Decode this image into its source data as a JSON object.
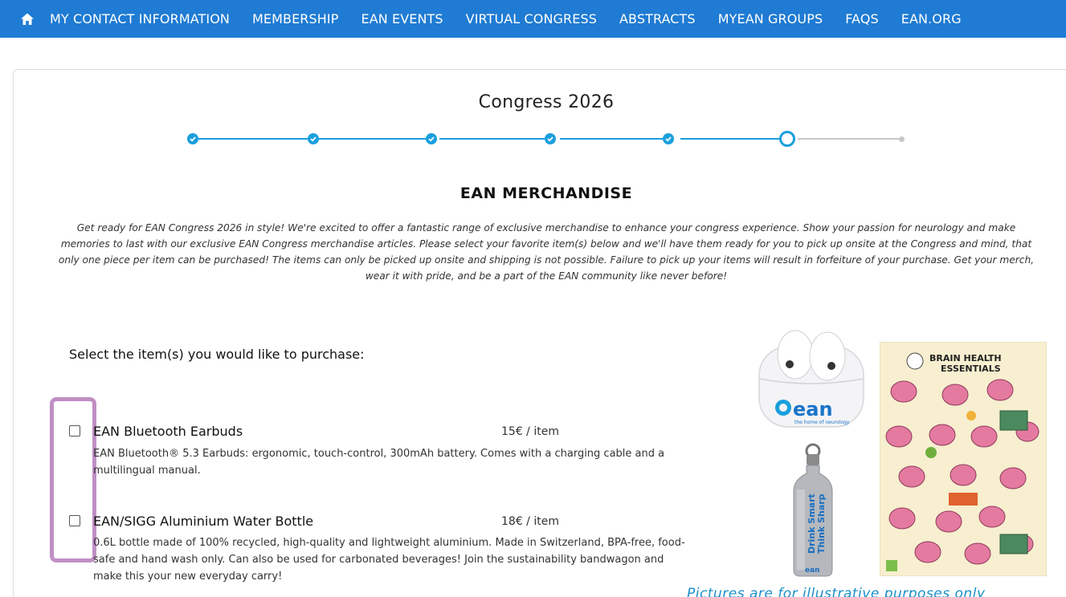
{
  "nav": {
    "items": [
      "MY CONTACT INFORMATION",
      "MEMBERSHIP",
      "EAN EVENTS",
      "VIRTUAL CONGRESS",
      "ABSTRACTS",
      "MYEAN GROUPS",
      "FAQS",
      "EAN.ORG"
    ]
  },
  "page": {
    "title": "Congress 2026",
    "stepper": {
      "total_steps": 7,
      "completed_steps": 5,
      "current_step": 6
    },
    "section_heading": "EAN MERCHANDISE",
    "intro": "Get ready for EAN Congress 2026 in style! We're excited to offer a fantastic range of exclusive merchandise to enhance your congress experience. Show your passion for neurology and make memories to last with our exclusive EAN Congress merchandise articles. Please select your favorite item(s) below and we'll have them ready for you to pick up onsite at the Congress and mind, that only one piece per item can be purchased! The items can only be picked up onsite and shipping is not possible. Failure to pick up your items will result in forfeiture of your purchase. Get your merch, wear it with pride, and be a part of the EAN community like never before!",
    "select_prompt": "Select the item(s) you would like to purchase:"
  },
  "items": [
    {
      "name": "EAN Bluetooth Earbuds",
      "price": "15€ / item",
      "description": "EAN Bluetooth® 5.3 Earbuds: ergonomic, touch-control, 300mAh battery. Comes with a charging cable and a multilingual manual.",
      "checked": false
    },
    {
      "name": "EAN/SIGG Aluminium Water Bottle",
      "price": "18€ / item",
      "description": "0.6L bottle made of 100% recycled, high-quality and lightweight aluminium. Made in Switzerland, BPA-free, food-safe and hand wash only. Can also be used for carbonated beverages! Join the sustainability bandwagon and make this your new everyday carry!",
      "checked": false
    }
  ],
  "product_images": {
    "earbuds_brand": "ean",
    "earbuds_tagline": "the home of neurology",
    "bottle_text_1": "Drink Smart",
    "bottle_text_2": "Think Sharp",
    "bottle_brand": "ean",
    "poster_title_1": "BRAIN HEALTH",
    "poster_title_2": "ESSENTIALS"
  },
  "caption": "Pictures are for illustrative purposes only",
  "colors": {
    "nav_bg": "#1f7bd3",
    "accent": "#1a9fdd",
    "highlight": "#c08fc4",
    "caption": "#1a8fc8"
  }
}
